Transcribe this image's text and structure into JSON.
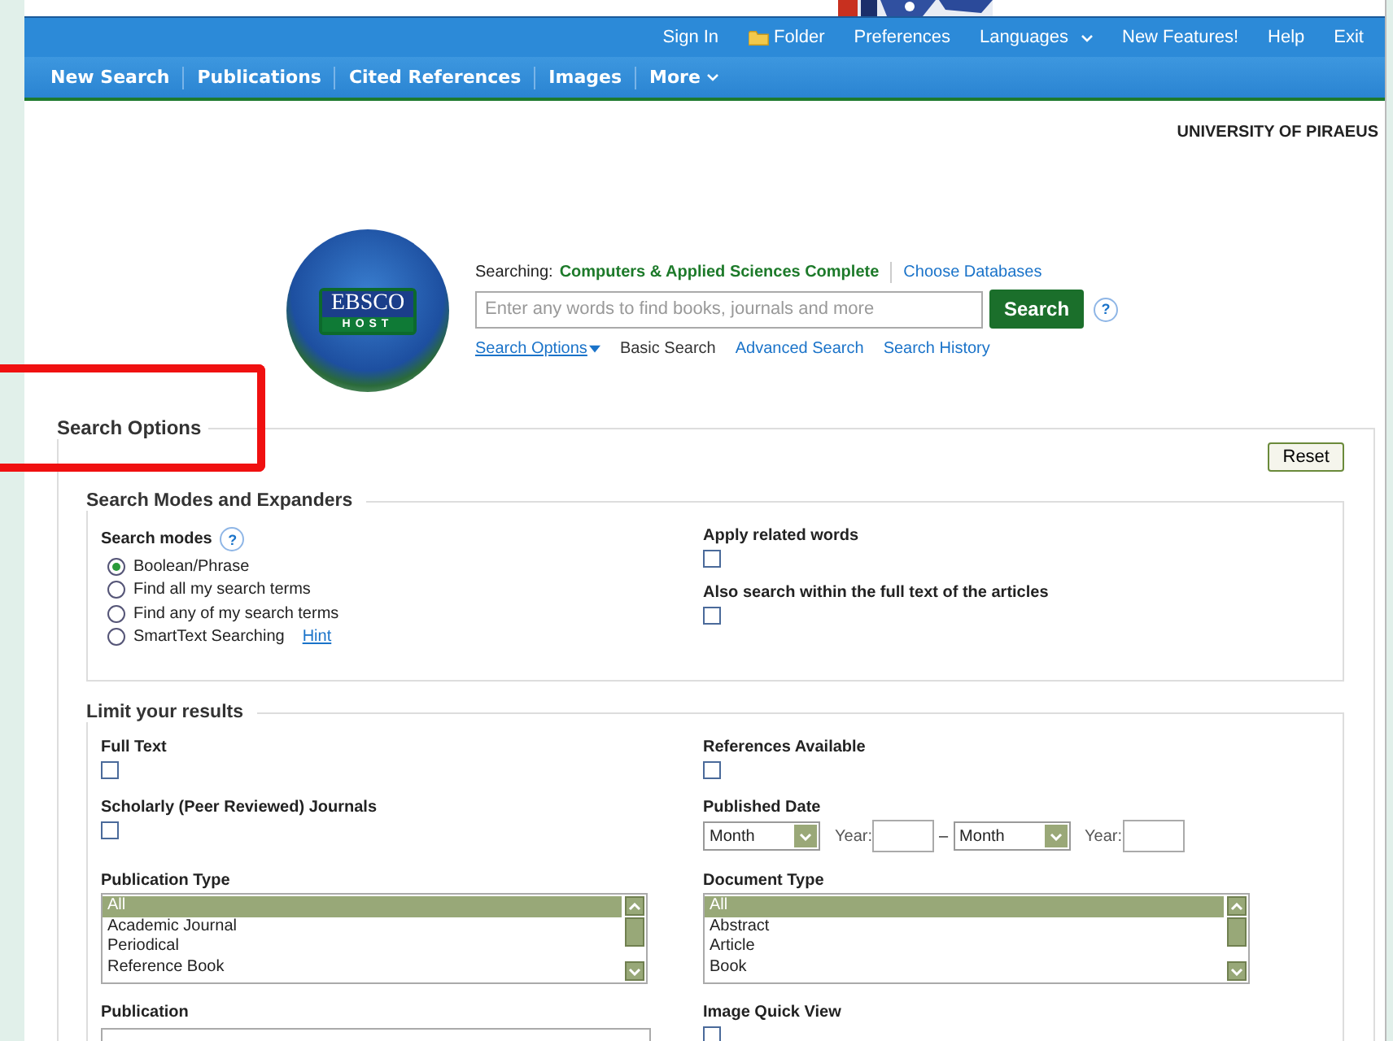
{
  "utility_links": [
    {
      "label": "Sign In",
      "kind": "link"
    },
    {
      "label": "Folder",
      "kind": "folder"
    },
    {
      "label": "Preferences",
      "kind": "link"
    },
    {
      "label": "Languages",
      "kind": "dropdown"
    },
    {
      "label": "New Features!",
      "kind": "link"
    },
    {
      "label": "Help",
      "kind": "link"
    },
    {
      "label": "Exit",
      "kind": "link"
    }
  ],
  "nav_tabs": [
    {
      "label": "New Search",
      "dropdown": false
    },
    {
      "label": "Publications",
      "dropdown": false
    },
    {
      "label": "Cited References",
      "dropdown": false
    },
    {
      "label": "Images",
      "dropdown": false
    },
    {
      "label": "More",
      "dropdown": true
    }
  ],
  "institution": "UNIVERSITY OF PIRAEUS",
  "logo": {
    "top": "EBSCO",
    "bottom": "HOST"
  },
  "search": {
    "searching_label": "Searching:",
    "database": "Computers & Applied Sciences Complete",
    "choose_link": "Choose Databases",
    "placeholder": "Enter any words to find books, journals and more",
    "button": "Search",
    "help": "?",
    "links": [
      {
        "label": "Search Options",
        "kind": "dropdown"
      },
      {
        "label": "Basic Search",
        "kind": "current"
      },
      {
        "label": "Advanced Search",
        "kind": "link"
      },
      {
        "label": "Search History",
        "kind": "link"
      }
    ]
  },
  "options": {
    "title": "Search Options",
    "reset": "Reset",
    "modes_section": {
      "title": "Search Modes and Expanders",
      "modes_label": "Search modes",
      "help": "?",
      "modes": [
        {
          "label": "Boolean/Phrase",
          "selected": true
        },
        {
          "label": "Find all my search terms",
          "selected": false
        },
        {
          "label": "Find any of my search terms",
          "selected": false
        },
        {
          "label": "SmartText Searching",
          "selected": false,
          "link": "Hint"
        }
      ],
      "expanders": [
        {
          "label": "Apply related words",
          "checked": false
        },
        {
          "label": "Also search within the full text of the articles",
          "checked": false
        }
      ]
    },
    "limits": {
      "title": "Limit your results",
      "items": [
        {
          "kind": "checkbox",
          "label": "Full Text",
          "checked": false
        },
        {
          "kind": "checkbox",
          "label": "References Available",
          "checked": false
        },
        {
          "kind": "checkbox",
          "label": "Scholarly (Peer Reviewed) Journals",
          "checked": false
        },
        {
          "kind": "date",
          "label": "Published Date",
          "from_month": "Month",
          "from_year_label": "Year:",
          "dash": "–",
          "to_month": "Month",
          "to_year_label": "Year:"
        },
        {
          "kind": "listbox",
          "label": "Publication Type",
          "options": [
            {
              "label": "All",
              "selected": true
            },
            {
              "label": "Academic Journal",
              "selected": false
            },
            {
              "label": "Periodical",
              "selected": false
            },
            {
              "label": "Reference Book",
              "selected": false
            }
          ]
        },
        {
          "kind": "listbox",
          "label": "Document Type",
          "options": [
            {
              "label": "All",
              "selected": true
            },
            {
              "label": "Abstract",
              "selected": false
            },
            {
              "label": "Article",
              "selected": false
            },
            {
              "label": "Book",
              "selected": false
            }
          ]
        },
        {
          "kind": "textfield",
          "label": "Publication"
        },
        {
          "kind": "checkbox",
          "label": "Image Quick View",
          "checked": false
        }
      ]
    }
  }
}
